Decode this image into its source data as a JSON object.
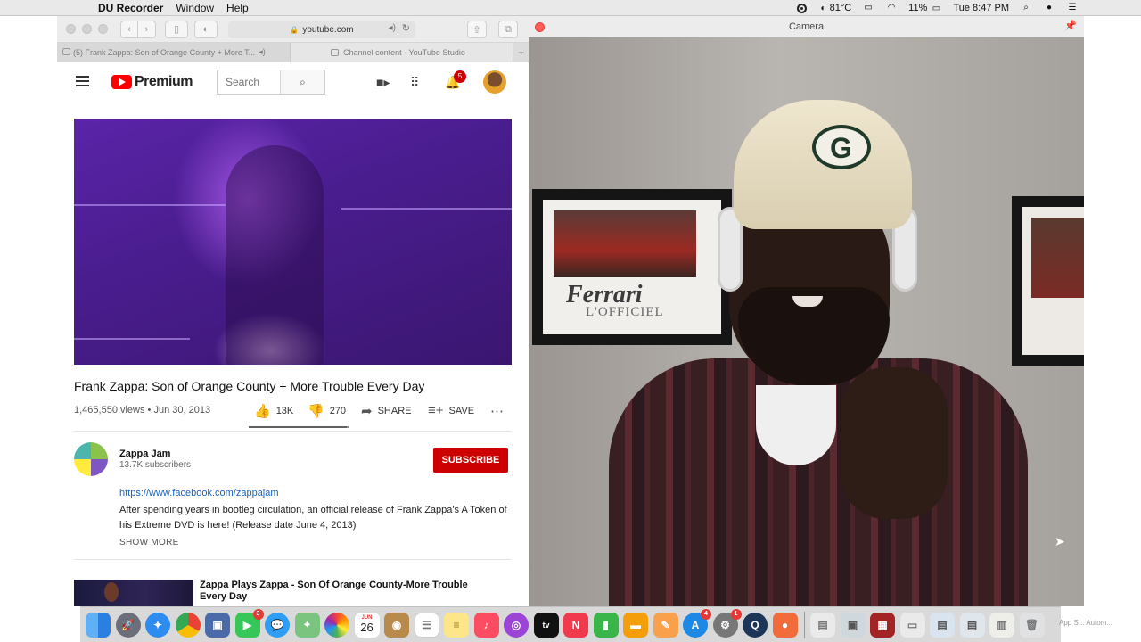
{
  "menubar": {
    "app_name": "DU Recorder",
    "menus": [
      "Window",
      "Help"
    ],
    "temperature": "81°C",
    "battery": "11%",
    "clock": "Tue 8:47 PM"
  },
  "safari": {
    "url": "youtube.com",
    "tabs": [
      {
        "label": "(5) Frank Zappa: Son of Orange County + More T..."
      },
      {
        "label": "Channel content - YouTube Studio"
      }
    ]
  },
  "youtube": {
    "logo_text": "Premium",
    "search_placeholder": "Search",
    "notification_count": "5",
    "video": {
      "title": "Frank Zappa: Son of Orange County + More Trouble Every Day",
      "views_date": "1,465,550 views • Jun 30, 2013",
      "likes": "13K",
      "dislikes": "270",
      "like_ratio": 0.98,
      "share_label": "SHARE",
      "save_label": "SAVE"
    },
    "channel": {
      "name": "Zappa Jam",
      "subscribers": "13.7K subscribers",
      "subscribe_label": "SUBSCRIBE"
    },
    "description": {
      "link": "https://www.facebook.com/zappajam",
      "text": "After spending years in bootleg circulation, an official release of Frank Zappa's A Token of his Extreme DVD is here!   (Release date June 4, 2013)",
      "show_more": "SHOW MORE"
    },
    "up_next": {
      "title": "Zappa Plays Zappa - Son Of Orange County-More Trouble Every Day"
    }
  },
  "camera": {
    "title": "Camera",
    "poster_brand": "Ferrari",
    "poster_sub": "L'OFFICIEL"
  },
  "dock": {
    "calendar_day": "26",
    "calendar_month": "JUN",
    "badges": {
      "facetime": "3",
      "app_store": "4",
      "system_prefs": "1"
    },
    "app_label": "App S... Autom..."
  }
}
